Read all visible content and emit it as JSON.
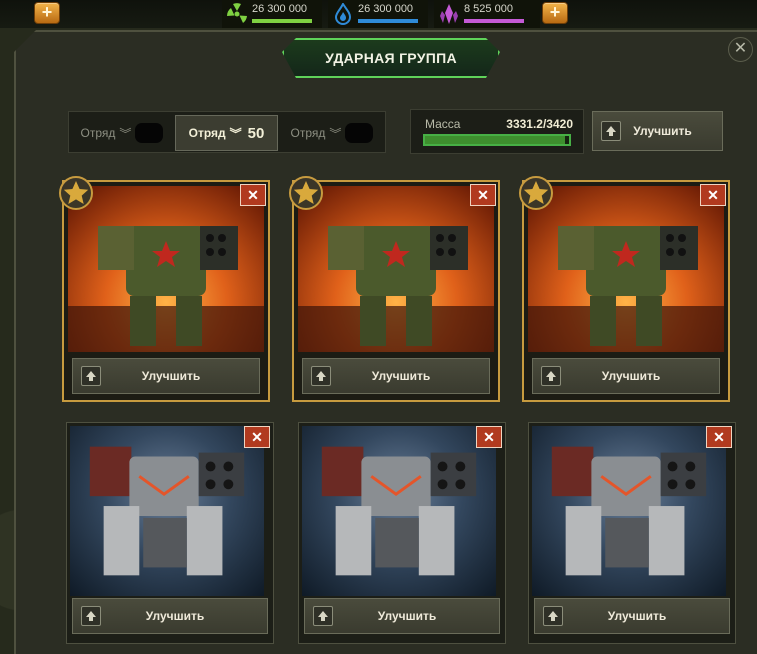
{
  "resources": [
    {
      "icon": "radiation-icon",
      "value": "26 300 000",
      "color": "#7fd142"
    },
    {
      "icon": "flame-icon",
      "value": "26 300 000",
      "color": "#2f8bd8"
    },
    {
      "icon": "crystal-icon",
      "value": "8 525 000",
      "color": "#c45ad6"
    }
  ],
  "header": {
    "title": "УДАРНАЯ ГРУППА",
    "close_label": "✕",
    "add_label": "+"
  },
  "squads": [
    {
      "label": "Отряд",
      "level": ""
    },
    {
      "label": "Отряд",
      "level": "50"
    },
    {
      "label": "Отряд",
      "level": ""
    }
  ],
  "mass": {
    "label": "Масса",
    "value": "3331.2/3420",
    "fraction": 0.974
  },
  "upgrade_label": "Улучшить",
  "cards": [
    {
      "art": "orange",
      "starred": true,
      "remove": "✕",
      "button": "Улучшить"
    },
    {
      "art": "orange",
      "starred": true,
      "remove": "✕",
      "button": "Улучшить"
    },
    {
      "art": "orange",
      "starred": true,
      "remove": "✕",
      "button": "Улучшить"
    },
    {
      "art": "blue",
      "starred": false,
      "remove": "✕",
      "button": "Улучшить"
    },
    {
      "art": "blue",
      "starred": false,
      "remove": "✕",
      "button": "Улучшить"
    },
    {
      "art": "blue",
      "starred": false,
      "remove": "✕",
      "button": "Улучшить"
    }
  ]
}
